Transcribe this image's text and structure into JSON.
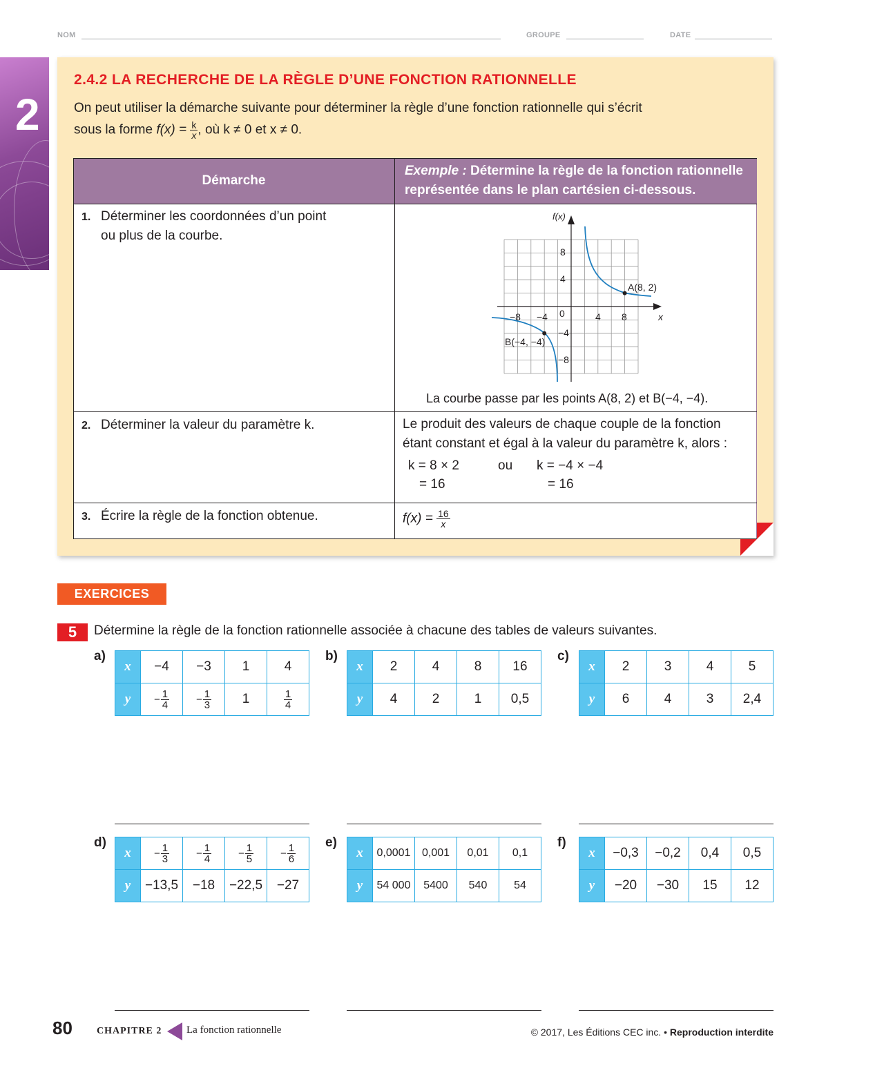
{
  "header": {
    "nom": "NOM",
    "groupe": "GROUPE",
    "date": "DATE"
  },
  "side_tab": {
    "chapter_number": "2"
  },
  "section": {
    "title": "2.4.2 LA RECHERCHE DE LA RÈGLE D’UNE FONCTION RATIONNELLE",
    "intro_line1": "On peut utiliser la démarche suivante pour déterminer la règle d’une fonction rationnelle qui s’écrit",
    "intro_line2_a": "sous la forme ",
    "intro_fx": "f(x) =",
    "intro_frac_num": "k",
    "intro_frac_den": "x",
    "intro_line2_b": ", où k ≠ 0 et x ≠ 0."
  },
  "table": {
    "head_left": "Démarche",
    "head_right_em": "Exemple :",
    "head_right_1": " Détermine la règle de la fonction rationnelle",
    "head_right_2": "représentée dans le plan cartésien ci-dessous.",
    "steps": [
      {
        "num": "1.",
        "line1": "Déterminer les coordonnées d’un point",
        "line2": "ou plus de la courbe."
      },
      {
        "num": "2.",
        "line1": "Déterminer la valeur du paramètre k.",
        "line2": ""
      },
      {
        "num": "3.",
        "line1": "Écrire la règle de la fonction obtenue.",
        "line2": ""
      }
    ],
    "graph": {
      "y_label": "f(x)",
      "x_label": "x",
      "origin": "0",
      "x_ticks": [
        "−8",
        "−4",
        "4",
        "8"
      ],
      "y_ticks": [
        "8",
        "4",
        "−4",
        "−8"
      ],
      "point_a": "A(8, 2)",
      "point_b": "B(−4, −4)"
    },
    "example_caption": "La courbe passe par les points A(8, 2) et B(−4, −4).",
    "step2_text1": "Le produit des valeurs de chaque couple de la fonction",
    "step2_text2": "étant constant et égal à la valeur du paramètre k, alors :",
    "calc1": "k = 8 × 2",
    "calc1b": "= 16",
    "calc_or": "ou",
    "calc2": "k = −4 × −4",
    "calc2b": "= 16",
    "answer_fx": "f(x) =",
    "answer_num": "16",
    "answer_den": "x"
  },
  "exercises": {
    "badge": "EXERCICES",
    "question_number": "5",
    "question_text": "Détermine la règle de la fonction rationnelle associée à chacune des tables de valeurs suivantes.",
    "x_head": "x",
    "y_head": "y",
    "tables": [
      {
        "label": "a)",
        "x": [
          "−4",
          "−3",
          "1",
          "4"
        ],
        "y": [
          "−1/4",
          "−1/3",
          "1",
          "1/4"
        ]
      },
      {
        "label": "b)",
        "x": [
          "2",
          "4",
          "8",
          "16"
        ],
        "y": [
          "4",
          "2",
          "1",
          "0,5"
        ]
      },
      {
        "label": "c)",
        "x": [
          "2",
          "3",
          "4",
          "5"
        ],
        "y": [
          "6",
          "4",
          "3",
          "2,4"
        ]
      },
      {
        "label": "d)",
        "x": [
          "−1/3",
          "−1/4",
          "−1/5",
          "−1/6"
        ],
        "y": [
          "−13,5",
          "−18",
          "−22,5",
          "−27"
        ]
      },
      {
        "label": "e)",
        "x": [
          "0,0001",
          "0,001",
          "0,01",
          "0,1"
        ],
        "y": [
          "54 000",
          "5400",
          "540",
          "54"
        ]
      },
      {
        "label": "f)",
        "x": [
          "−0,3",
          "−0,2",
          "0,4",
          "0,5"
        ],
        "y": [
          "−20",
          "−30",
          "15",
          "12"
        ]
      }
    ]
  },
  "footer": {
    "page_number": "80",
    "chapter": "CHAPITRE 2",
    "chapter_title": "La fonction rationnelle",
    "copyright": "© 2017, Les Éditions CEC inc. •",
    "copyright_bold": " Reproduction interdite"
  },
  "colors": {
    "card_bg": "#fde9bd",
    "title_red": "#e31e24",
    "table_head": "#9f7aa0",
    "curve_blue": "#1f7fc0",
    "table_border": "#29abe2",
    "table_head_cell": "#5bc5ef",
    "exercise_orange": "#f15a24"
  }
}
